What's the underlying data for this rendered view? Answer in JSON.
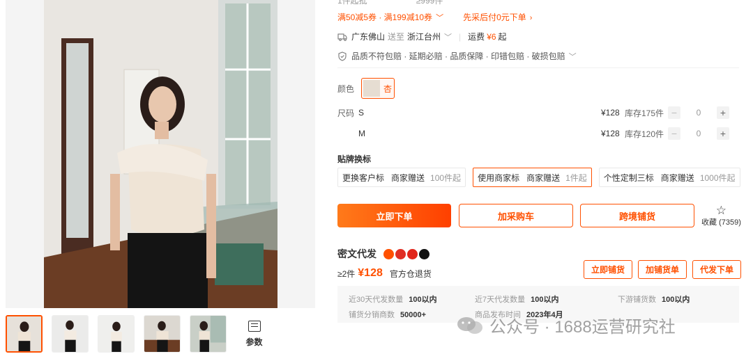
{
  "offer_strip": {
    "moq": "1件起批",
    "range": "≥999件"
  },
  "promo": {
    "coupon_text": "满50减5券 · 满199减10券",
    "pay_later": "先采后付0元下单"
  },
  "shipping": {
    "from": "广东佛山",
    "to_word": "送至",
    "to": "浙江台州",
    "fee_label": "运费",
    "fee": "¥6",
    "fee_suffix": "起"
  },
  "guarantees": "品质不符包赔 · 延期必赔 · 品质保障 · 印错包赔 · 破损包赔",
  "color": {
    "label": "颜色",
    "selected": "杏"
  },
  "size": {
    "label": "尺码",
    "rows": [
      {
        "size": "S",
        "price": "¥128",
        "stock": "库存175件",
        "qty": "0"
      },
      {
        "size": "M",
        "price": "¥128",
        "stock": "库存120件",
        "qty": "0"
      }
    ]
  },
  "label_swap": {
    "title": "贴牌换标",
    "options": [
      {
        "name": "更换客户标",
        "tag": "商家赠送",
        "moq": "100件起"
      },
      {
        "name": "使用商家标",
        "tag": "商家赠送",
        "moq": "1件起"
      },
      {
        "name": "个性定制三标",
        "tag": "商家赠送",
        "moq": "1000件起"
      }
    ]
  },
  "actions": {
    "buy": "立即下单",
    "cart": "加采购车",
    "cross": "跨境铺货",
    "fav": "收藏 (7359)"
  },
  "miwen": {
    "title": "密文代发",
    "count": "≥2件",
    "price": "¥128",
    "warehouse": "官方仓退货",
    "buttons": [
      "立即铺货",
      "加铺货单",
      "代发下单"
    ]
  },
  "stats": {
    "s1_k": "近30天代发数量",
    "s1_v": "100以内",
    "s2_k": "近7天代发数量",
    "s2_v": "100以内",
    "s3_k": "下游铺货数",
    "s3_v": "100以内",
    "s4_k": "铺货分销商数",
    "s4_v": "50000+",
    "s5_k": "商品发布时间",
    "s5_v": "2023年4月"
  },
  "gallery": {
    "params_label": "参数"
  },
  "watermark": "公众号 · 1688运营研究社",
  "colors": {
    "accent": "#ff5000",
    "grad_start": "#ff7a1a",
    "grad_end": "#ff4000"
  },
  "icons": [
    "truck-icon",
    "shield-icon",
    "star-icon",
    "params-icon",
    "chevron-down-icon",
    "chevron-right-icon",
    "plus-icon",
    "minus-icon"
  ]
}
